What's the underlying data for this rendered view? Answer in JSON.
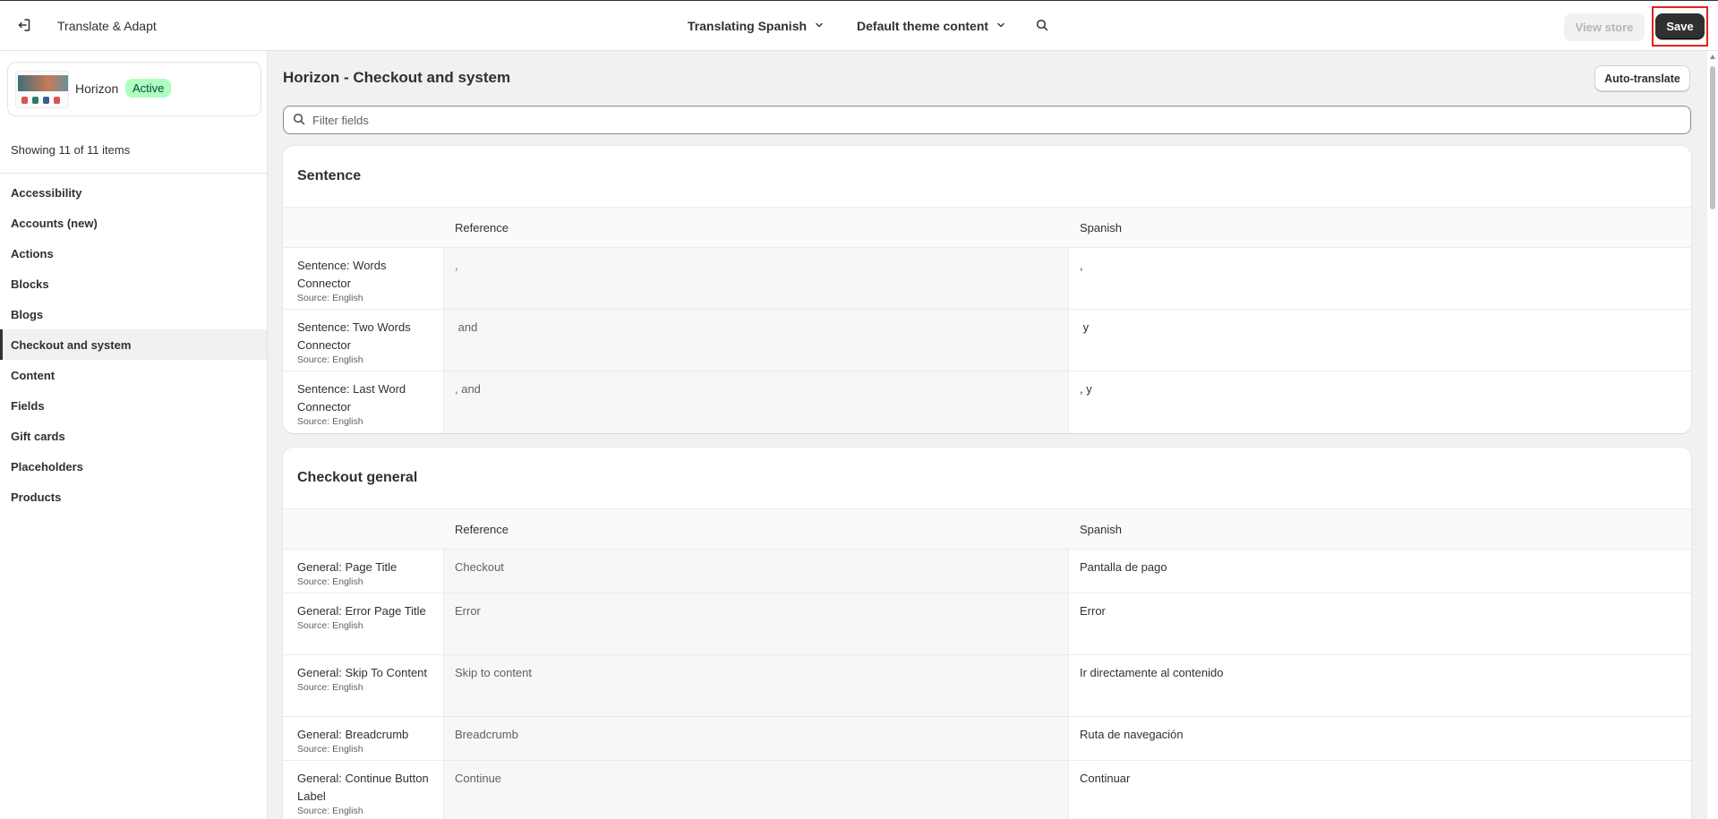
{
  "header": {
    "app_title": "Translate & Adapt",
    "language_dropdown": "Translating Spanish",
    "content_dropdown": "Default theme content",
    "view_store_label": "View store",
    "save_label": "Save"
  },
  "sidebar": {
    "theme": {
      "name": "Horizon",
      "status": "Active"
    },
    "count_text": "Showing 11 of 11 items",
    "items": [
      {
        "label": "Accessibility"
      },
      {
        "label": "Accounts (new)"
      },
      {
        "label": "Actions"
      },
      {
        "label": "Blocks"
      },
      {
        "label": "Blogs"
      },
      {
        "label": "Checkout and system"
      },
      {
        "label": "Content"
      },
      {
        "label": "Fields"
      },
      {
        "label": "Gift cards"
      },
      {
        "label": "Placeholders"
      },
      {
        "label": "Products"
      }
    ],
    "active_item": "Checkout and system"
  },
  "main": {
    "title": "Horizon - Checkout and system",
    "auto_translate_label": "Auto-translate",
    "filter_placeholder": "Filter fields",
    "sections": [
      {
        "title": "Sentence",
        "col_reference": "Reference",
        "col_target": "Spanish",
        "rows": [
          {
            "key": "Sentence: Words Connector",
            "source": "Source: English",
            "reference": ",",
            "translation": ","
          },
          {
            "key": "Sentence: Two Words Connector",
            "source": "Source: English",
            "reference": " and",
            "translation": " y"
          },
          {
            "key": "Sentence: Last Word Connector",
            "source": "Source: English",
            "reference": ", and",
            "translation": ", y"
          }
        ]
      },
      {
        "title": "Checkout general",
        "col_reference": "Reference",
        "col_target": "Spanish",
        "rows": [
          {
            "key": "General: Page Title",
            "source": "Source: English",
            "reference": "Checkout",
            "translation": "Pantalla de pago"
          },
          {
            "key": "General: Error Page Title",
            "source": "Source: English",
            "reference": "Error",
            "translation": "Error"
          },
          {
            "key": "General: Skip To Content",
            "source": "Source: English",
            "reference": "Skip to content",
            "translation": "Ir directamente al contenido"
          },
          {
            "key": "General: Breadcrumb",
            "source": "Source: English",
            "reference": "Breadcrumb",
            "translation": "Ruta de navegación"
          },
          {
            "key": "General: Continue Button Label",
            "source": "Source: English",
            "reference": "Continue",
            "translation": "Continuar"
          }
        ]
      }
    ]
  },
  "colors": {
    "primary_button": "#303030",
    "active_badge_bg": "#affebf",
    "active_badge_text": "#014b40",
    "highlight_border": "#e41f1f"
  },
  "icons": [
    "exit-icon",
    "chevron-down-icon",
    "search-icon"
  ]
}
